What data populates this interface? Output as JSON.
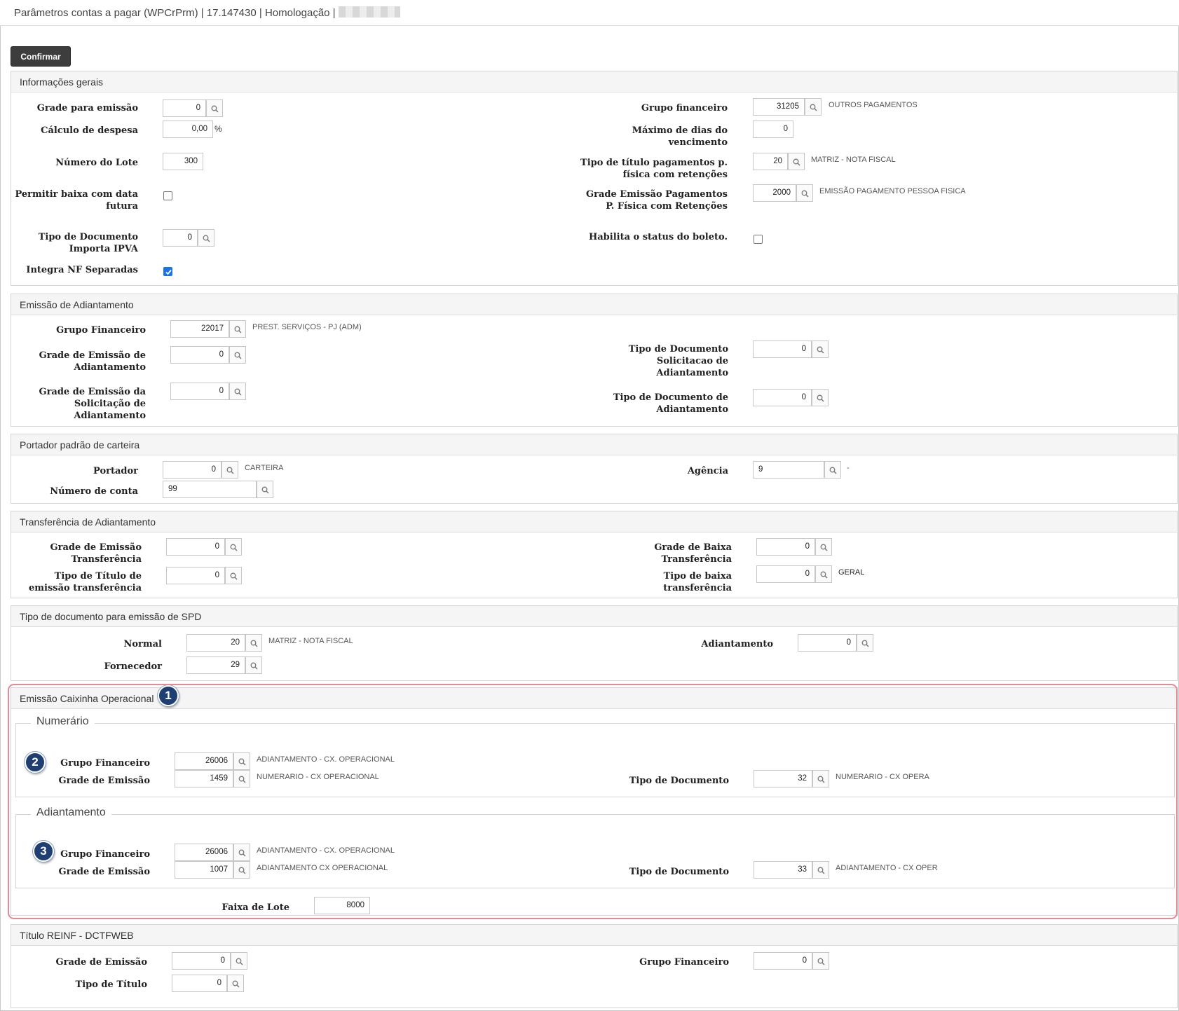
{
  "window": {
    "title": "Parâmetros contas a pagar (WPCrPrm) | 17.147430 | Homologação |"
  },
  "toolbar": {
    "confirm_label": "Confirmar"
  },
  "gerais": {
    "title": "Informações gerais",
    "grade_emissao": {
      "label": "Grade para emissão",
      "value": "0"
    },
    "calculo_despesa": {
      "label": "Cálculo de despesa",
      "value": "0,00",
      "unit": "%"
    },
    "numero_lote": {
      "label": "Número do Lote",
      "value": "300"
    },
    "permitir_baixa": {
      "label": "Permitir baixa com data futura",
      "checked": false
    },
    "tipo_doc_ipva": {
      "label": "Tipo de Documento Importa IPVA",
      "value": "0"
    },
    "integra_nf": {
      "label": "Integra NF Separadas",
      "checked": true
    },
    "grupo_financeiro": {
      "label": "Grupo financeiro",
      "value": "31205",
      "desc": "OUTROS PAGAMENTOS"
    },
    "maximo_dias": {
      "label": "Máximo de dias do vencimento",
      "value": "0"
    },
    "tipo_titulo_pf": {
      "label": "Tipo de título pagamentos p. física com retenções",
      "value": "20",
      "desc": "MATRIZ - NOTA FISCAL"
    },
    "grade_emissao_pf": {
      "label": "Grade Emissão Pagamentos P. Física com Retenções",
      "value": "2000",
      "desc": "EMISSÃO PAGAMENTO PESSOA FISICA"
    },
    "habilita_boleto": {
      "label": "Habilita o status do boleto.",
      "checked": false
    }
  },
  "adiantamento": {
    "title": "Emissão de Adiantamento",
    "grupo_financeiro": {
      "label": "Grupo Financeiro",
      "value": "22017",
      "desc": "PREST. SERVIÇOS - PJ (ADM)"
    },
    "grade_emissao": {
      "label": "Grade de Emissão de Adiantamento",
      "value": "0"
    },
    "grade_solicitacao": {
      "label": "Grade de Emissão da Solicitação de Adiantamento",
      "value": "0"
    },
    "tipo_doc_solicitacao": {
      "label": "Tipo de Documento Solicitacao de Adiantamento",
      "value": "0"
    },
    "tipo_doc_adiantamento": {
      "label": "Tipo de Documento de Adiantamento",
      "value": "0"
    }
  },
  "portador": {
    "title": "Portador padrão de carteira",
    "portador": {
      "label": "Portador",
      "value": "0",
      "desc": "CARTEIRA"
    },
    "numero_conta": {
      "label": "Número de conta",
      "value": "99"
    },
    "agencia": {
      "label": "Agência",
      "value": "9",
      "desc": "-"
    }
  },
  "transferencia": {
    "title": "Transferência de Adiantamento",
    "grade_emissao": {
      "label": "Grade de Emissão Transferência",
      "value": "0"
    },
    "tipo_titulo": {
      "label": "Tipo de Título de emissão transferência",
      "value": "0"
    },
    "grade_baixa": {
      "label": "Grade de Baixa Transferência",
      "value": "0"
    },
    "tipo_baixa": {
      "label": "Tipo de baixa transferência",
      "value": "0",
      "desc": "GERAL"
    }
  },
  "spd": {
    "title": "Tipo de documento para emissão de SPD",
    "normal": {
      "label": "Normal",
      "value": "20",
      "desc": "MATRIZ - NOTA FISCAL"
    },
    "fornecedor": {
      "label": "Fornecedor",
      "value": "29"
    },
    "adiantamento": {
      "label": "Adiantamento",
      "value": "0"
    }
  },
  "caixinha": {
    "title": "Emissão Caixinha Operacional",
    "badges": [
      "1",
      "2",
      "3"
    ],
    "numerario": {
      "title": "Numerário",
      "grupo_financeiro": {
        "label": "Grupo Financeiro",
        "value": "26006",
        "desc": "ADIANTAMENTO - CX. OPERACIONAL"
      },
      "grade_emissao": {
        "label": "Grade de Emissão",
        "value": "1459",
        "desc": "NUMERARIO - CX OPERACIONAL"
      },
      "tipo_documento": {
        "label": "Tipo de Documento",
        "value": "32",
        "desc": "NUMERARIO - CX OPERA"
      }
    },
    "adiantamento": {
      "title": "Adiantamento",
      "grupo_financeiro": {
        "label": "Grupo Financeiro",
        "value": "26006",
        "desc": "ADIANTAMENTO - CX. OPERACIONAL"
      },
      "grade_emissao": {
        "label": "Grade de Emissão",
        "value": "1007",
        "desc": "ADIANTAMENTO CX OPERACIONAL"
      },
      "tipo_documento": {
        "label": "Tipo de Documento",
        "value": "33",
        "desc": "ADIANTAMENTO - CX OPER"
      }
    },
    "faixa_lote": {
      "label": "Faixa de Lote",
      "value": "8000"
    }
  },
  "reinf": {
    "title": "Título REINF - DCTFWEB",
    "grade_emissao": {
      "label": "Grade de Emissão",
      "value": "0"
    },
    "tipo_titulo": {
      "label": "Tipo de Título",
      "value": "0"
    },
    "grupo_financeiro": {
      "label": "Grupo Financeiro",
      "value": "0"
    }
  },
  "icons": {
    "lookup": "search-icon",
    "check": "check-icon"
  }
}
